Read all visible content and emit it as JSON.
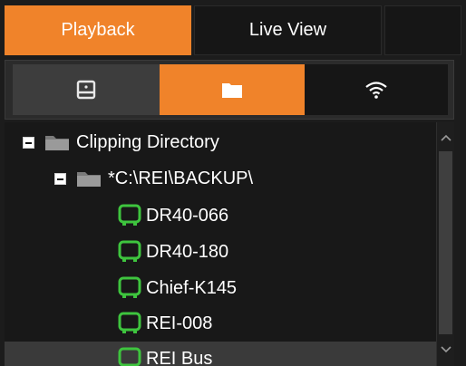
{
  "tabs": [
    {
      "label": "Playback",
      "active": true
    },
    {
      "label": "Live View",
      "active": false
    }
  ],
  "sources": [
    {
      "icon": "hard-drive-icon",
      "active": false
    },
    {
      "icon": "folder-icon",
      "active": true
    },
    {
      "icon": "wifi-icon",
      "active": false
    }
  ],
  "tree": {
    "root": {
      "label": "Clipping Directory",
      "expanded": true,
      "icon": "folder-icon"
    },
    "folder": {
      "label": "*C:\\REI\\BACKUP\\",
      "expanded": true,
      "icon": "folder-icon"
    },
    "items": [
      {
        "label": "DR40-066",
        "icon": "bus-icon"
      },
      {
        "label": "DR40-180",
        "icon": "bus-icon"
      },
      {
        "label": "Chief-K145",
        "icon": "bus-icon"
      },
      {
        "label": "REI-008",
        "icon": "bus-icon"
      },
      {
        "label": "REI Bus",
        "icon": "bus-icon",
        "selected": true
      }
    ]
  },
  "colors": {
    "accent": "#f0832a",
    "bus_icon": "#3ec43e",
    "background": "#1c1c1c",
    "text": "#ffffff"
  }
}
